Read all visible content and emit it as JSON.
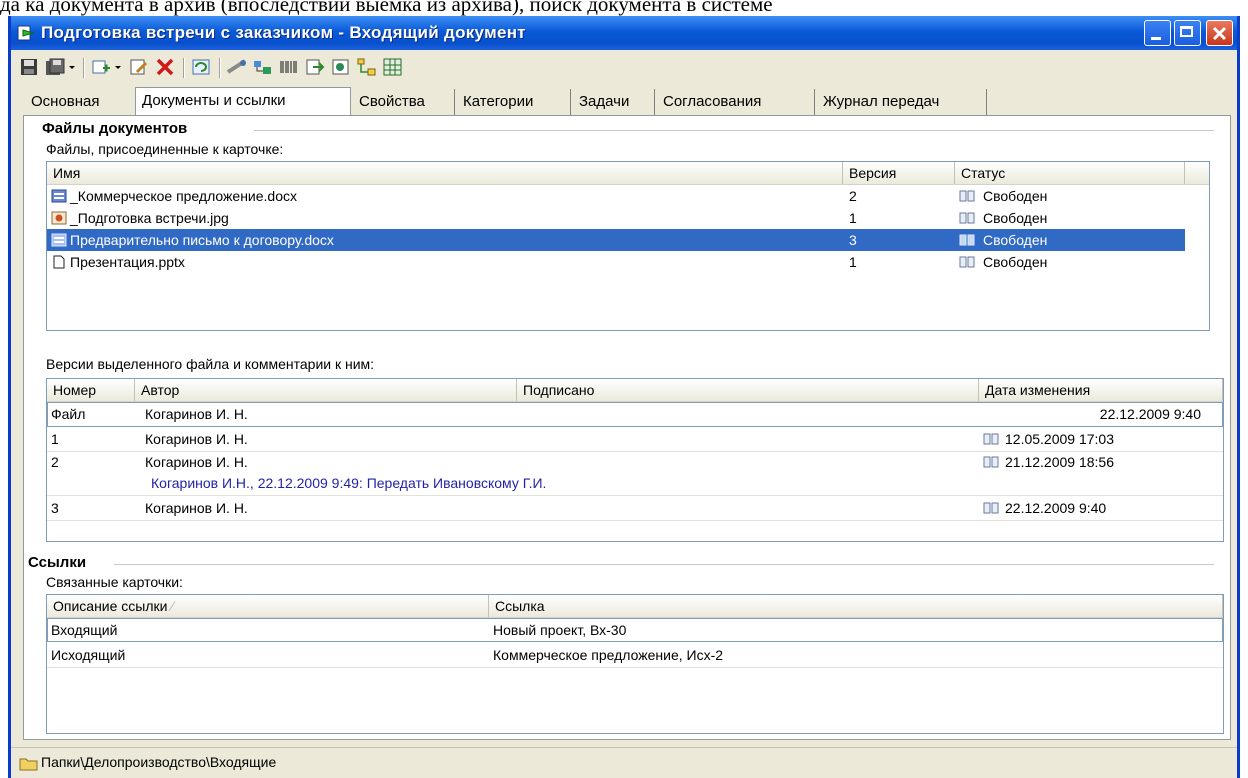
{
  "doc_top_line": "да ка документа в архив (впоследствии выемка из архива), поиск документа в системе",
  "window": {
    "title": "Подготовка встречи с заказчиком - Входящий документ"
  },
  "tabs": [
    {
      "label": "Основная"
    },
    {
      "label": "Документы и ссылки"
    },
    {
      "label": "Свойства"
    },
    {
      "label": "Категории"
    },
    {
      "label": "Задачи"
    },
    {
      "label": "Согласования"
    },
    {
      "label": "Журнал передач"
    }
  ],
  "files_section": {
    "title": "Файлы документов",
    "label": "Файлы, присоединенные к карточке:",
    "columns": {
      "name": "Имя",
      "version": "Версия",
      "status": "Статус"
    },
    "rows": [
      {
        "name": "_Коммерческое предложение.docx",
        "version": "2",
        "status": "Свободен",
        "icon": "word-icon"
      },
      {
        "name": "_Подготовка встречи.jpg",
        "version": "1",
        "status": "Свободен",
        "icon": "image-icon"
      },
      {
        "name": "Предварительно письмо к договору.docx",
        "version": "3",
        "status": "Свободен",
        "icon": "word-icon"
      },
      {
        "name": "Презентация.pptx",
        "version": "1",
        "status": "Свободен",
        "icon": "blank-file-icon"
      }
    ]
  },
  "versions_section": {
    "label": "Версии выделенного файла и комментарии к ним:",
    "columns": {
      "number": "Номер",
      "author": "Автор",
      "signed": "Подписано",
      "date": "Дата изменения"
    },
    "rows": [
      {
        "number": "Файл",
        "author": "Когаринов И. Н.",
        "date": "22.12.2009 9:40",
        "comment": ""
      },
      {
        "number": "1",
        "author": "Когаринов И. Н.",
        "date": "12.05.2009 17:03",
        "comment": ""
      },
      {
        "number": "2",
        "author": "Когаринов И. Н.",
        "date": "21.12.2009 18:56",
        "comment": "Когаринов И.Н., 22.12.2009 9:49: Передать Ивановскому Г.И."
      },
      {
        "number": "3",
        "author": "Когаринов И. Н.",
        "date": "22.12.2009 9:40",
        "comment": ""
      }
    ]
  },
  "links_section": {
    "title": "Ссылки",
    "label": "Связанные карточки:",
    "columns": {
      "description": "Описание ссылки",
      "link": "Ссылка"
    },
    "rows": [
      {
        "description": "Входящий",
        "link": "Новый проект, Вх-30"
      },
      {
        "description": "Исходящий",
        "link": "Коммерческое предложение, Исх-2"
      }
    ]
  },
  "status_bar": {
    "path": "Папки\\Делопроизводство\\Входящие"
  },
  "toolbar": {
    "icons": [
      "save-icon",
      "save-as-icon",
      "dropdown-arrow-icon",
      "new-card-icon",
      "dropdown-arrow-icon",
      "edit-icon",
      "delete-icon",
      "refresh-icon",
      "route-icon",
      "tree-icon",
      "barcode-icon",
      "export-icon",
      "scan-icon",
      "hierarchy-icon",
      "grid-icon"
    ]
  },
  "colors": {
    "titlebar": "#0a5ad8",
    "selection": "#316ac5",
    "comment": "#2323a8",
    "window_bg": "#ece9d8"
  }
}
